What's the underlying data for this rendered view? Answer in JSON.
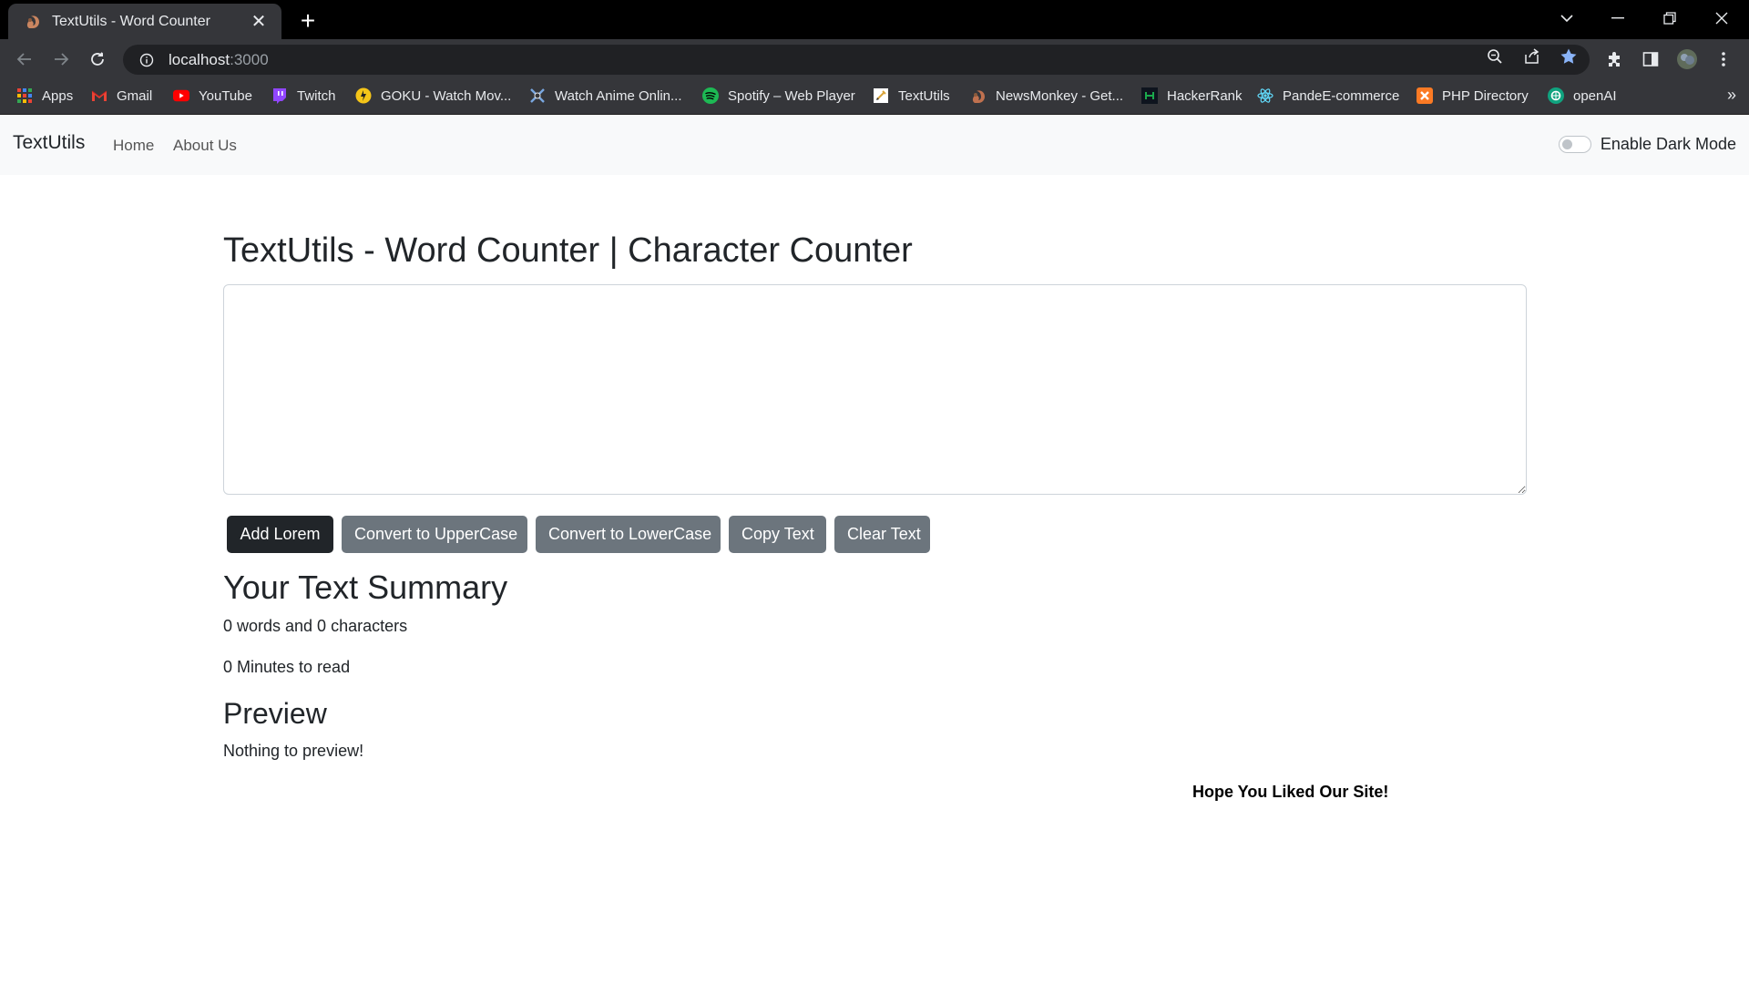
{
  "browser": {
    "tab": {
      "title": "TextUtils - Word Counter",
      "favicon": "squirrel-favicon",
      "close_glyph": "✕"
    },
    "new_tab_glyph": "+",
    "address": {
      "host": "localhost",
      "port": ":3000"
    },
    "bookmarks": [
      {
        "label": "Apps",
        "icon": "apps-grid-icon",
        "color": "#ea4335"
      },
      {
        "label": "Gmail",
        "icon": "gmail-icon",
        "color": "#ea4335"
      },
      {
        "label": "YouTube",
        "icon": "youtube-icon",
        "color": "#ff0000"
      },
      {
        "label": "Twitch",
        "icon": "twitch-icon",
        "color": "#9146ff"
      },
      {
        "label": "GOKU - Watch Mov...",
        "icon": "goku-icon",
        "color": "#f5c518"
      },
      {
        "label": "Watch Anime Onlin...",
        "icon": "anime-icon",
        "color": "#4a90d9"
      },
      {
        "label": "Spotify – Web Player",
        "icon": "spotify-icon",
        "color": "#1db954"
      },
      {
        "label": "TextUtils",
        "icon": "textutils-icon",
        "color": "#e8eaed"
      },
      {
        "label": "NewsMonkey - Get...",
        "icon": "newsmonkey-icon",
        "color": "#c0714f"
      },
      {
        "label": "HackerRank",
        "icon": "hackerrank-icon",
        "color": "#1ba94c"
      },
      {
        "label": "PandeE-commerce",
        "icon": "react-icon",
        "color": "#61dafb"
      },
      {
        "label": "PHP Directory",
        "icon": "xampp-icon",
        "color": "#fb7a24"
      },
      {
        "label": "openAI",
        "icon": "openai-icon",
        "color": "#10a37f"
      }
    ],
    "bookmarks_more_glyph": "»"
  },
  "navbar": {
    "brand": "TextUtils",
    "links": [
      "Home",
      "About Us"
    ],
    "dark_mode_label": "Enable Dark Mode",
    "dark_mode_enabled": false
  },
  "main": {
    "heading": "TextUtils - Word Counter | Character Counter",
    "textarea_value": "",
    "buttons": [
      "Add Lorem",
      "Convert to UpperCase",
      "Convert to LowerCase",
      "Copy Text",
      "Clear Text"
    ],
    "summary_heading": "Your Text Summary",
    "words_chars": "0 words and 0 characters",
    "minutes_to_read": "0 Minutes to read",
    "preview_heading": "Preview",
    "preview_text": "Nothing to preview!",
    "footer": "Hope You Liked Our Site!"
  },
  "colors": {
    "chrome_dark": "#35363a",
    "tabstrip": "#000000",
    "navbar_bg": "#f8f9fa",
    "btn_dark": "#212529",
    "btn_secondary": "#6c757d",
    "bookmark_star": "#8ab4f8"
  }
}
